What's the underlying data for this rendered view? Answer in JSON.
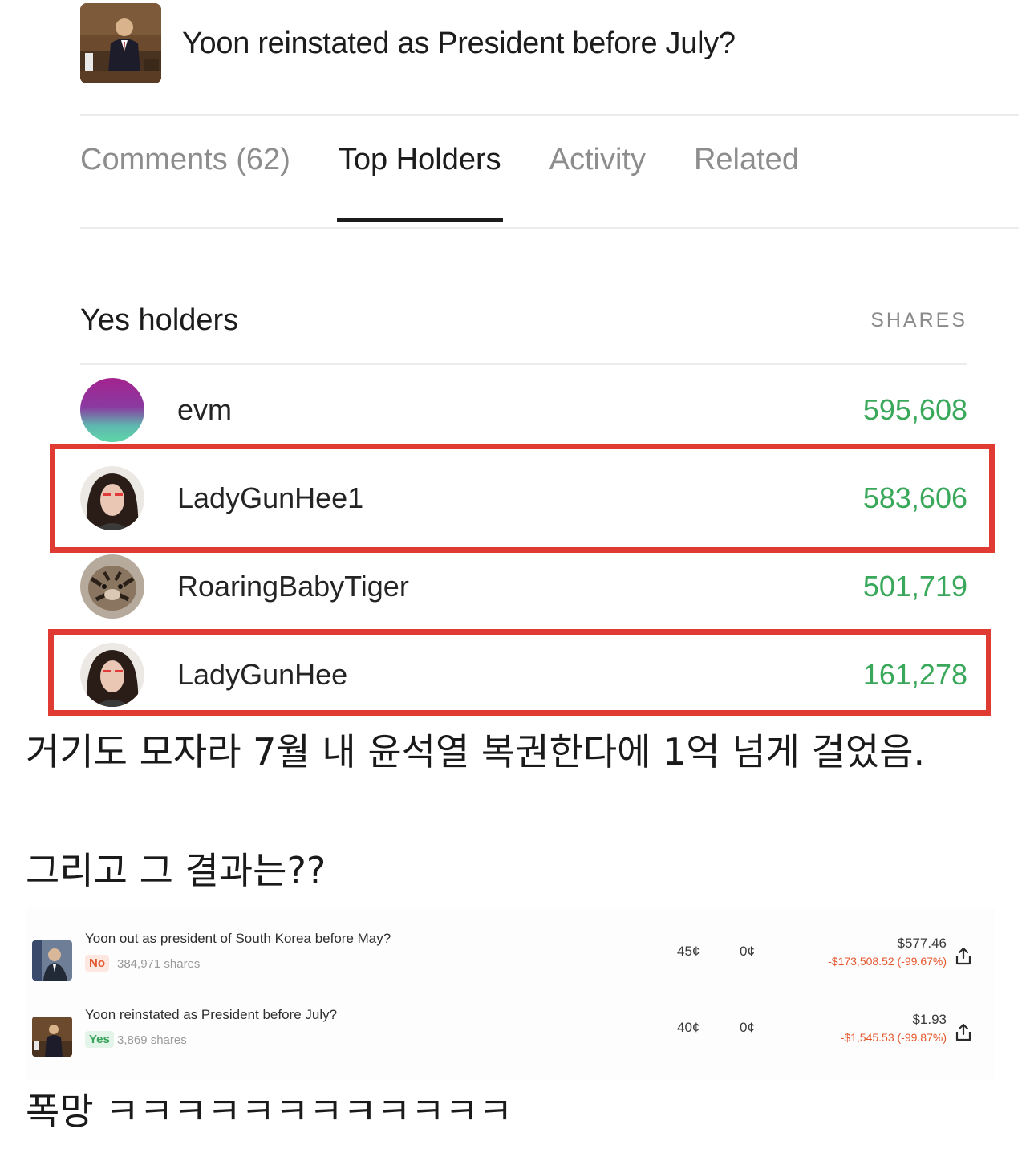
{
  "market": {
    "title": "Yoon reinstated as President before July?",
    "thumbnail_icon": "president-photo-thumbnail"
  },
  "tabs": [
    {
      "label": "Comments (62)",
      "active": false
    },
    {
      "label": "Top Holders",
      "active": true
    },
    {
      "label": "Activity",
      "active": false
    },
    {
      "label": "Related",
      "active": false
    }
  ],
  "holders": {
    "title": "Yes holders",
    "shares_label": "SHARES",
    "items": [
      {
        "name": "evm",
        "shares": "595,608",
        "highlighted": false
      },
      {
        "name": "LadyGunHee1",
        "shares": "583,606",
        "highlighted": true
      },
      {
        "name": "RoaringBabyTiger",
        "shares": "501,719",
        "highlighted": false
      },
      {
        "name": "LadyGunHee",
        "shares": "161,278",
        "highlighted": true
      }
    ]
  },
  "post_text": {
    "line1": "거기도 모자라 7월 내 윤석열 복권한다에 1억 넘게 걸었음.",
    "line2": "그리고 그 결과는??",
    "line3": "폭망 ㅋㅋㅋㅋㅋㅋㅋㅋㅋㅋㅋㅋ"
  },
  "positions": [
    {
      "title": "Yoon out as president of South Korea before May?",
      "outcome": "No",
      "shares": "384,971 shares",
      "avg_price": "45¢",
      "current_price": "0¢",
      "value": "$577.46",
      "pnl": "-$173,508.52 (-99.67%)"
    },
    {
      "title": "Yoon reinstated as President before July?",
      "outcome": "Yes",
      "shares": "3,869 shares",
      "avg_price": "40¢",
      "current_price": "0¢",
      "value": "$1.93",
      "pnl": "-$1,545.53 (-99.87%)"
    }
  ],
  "colors": {
    "accent_green": "#3aa85a",
    "highlight_red": "#e03b32",
    "loss_red": "#e4572e"
  }
}
